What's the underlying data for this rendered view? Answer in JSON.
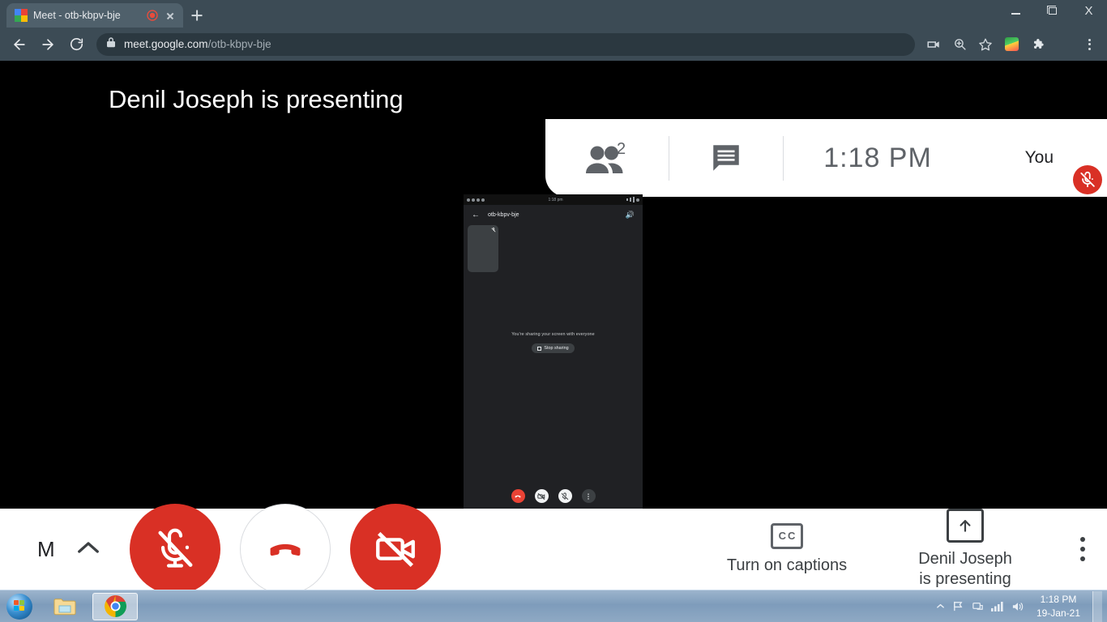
{
  "browser": {
    "tab": {
      "title": "Meet - otb-kbpv-bje",
      "favicon": "google-meet-favicon",
      "recording_indicator": "tab-recording-dot",
      "close": "close-icon"
    },
    "new_tab_label": "+",
    "window_controls": {
      "minimize": "minimize-icon",
      "restore": "restore-icon",
      "close": "X"
    },
    "nav": {
      "back": "back-arrow-icon",
      "forward": "forward-arrow-icon",
      "reload": "reload-icon"
    },
    "omnibox": {
      "lock": "lock-icon",
      "domain": "meet.google.com",
      "path": "/otb-kbpv-bje"
    },
    "toolbar_icons": [
      "cast-icon",
      "zoom-icon",
      "bookmark-star-icon",
      "idm-extension-icon",
      "extensions-puzzle-icon",
      "profile-avatar",
      "chrome-menu-kebab"
    ]
  },
  "meet": {
    "presenting_banner": {
      "avatar": "presenter-avatar",
      "text": "Denil Joseph is presenting"
    },
    "header_panel": {
      "people": {
        "icon": "people-icon",
        "count": "2"
      },
      "chat": {
        "icon": "chat-icon"
      },
      "time": "1:18 PM",
      "self": {
        "label": "You",
        "avatar": "self-avatar",
        "mic_badge": "mic-off-icon"
      }
    },
    "shared_screen": {
      "status_bar_left": "android-status-icons",
      "status_bar_time": "1:18 pm",
      "status_bar_right": "signal-wifi-battery",
      "back_icon": "back-arrow-icon",
      "meeting_code": "otb-kbpv-bje",
      "speaker_icon": "speaker-icon",
      "tile": {
        "avatar": "participant-avatar",
        "mic": "mic-off-icon"
      },
      "message": "You're sharing your screen with everyone",
      "stop_button": {
        "icon": "stop-present-icon",
        "label": "Stop sharing"
      },
      "controls": [
        {
          "name": "hangup",
          "icon": "phone-hangup-icon",
          "style": "hang"
        },
        {
          "name": "camera-off",
          "icon": "camera-off-icon",
          "style": "light"
        },
        {
          "name": "mic-off",
          "icon": "mic-off-icon",
          "style": "light"
        },
        {
          "name": "more-options",
          "icon": "kebab-icon",
          "style": "dark"
        }
      ]
    },
    "control_bar": {
      "meeting_details": "M",
      "expand_icon": "chevron-up-icon",
      "mic_button": {
        "icon": "mic-off-icon",
        "state": "muted"
      },
      "hangup_button": {
        "icon": "phone-hangup-icon"
      },
      "camera_button": {
        "icon": "camera-off-icon",
        "state": "off"
      },
      "captions": {
        "icon": "cc-icon",
        "label": "Turn on captions"
      },
      "present": {
        "icon": "present-up-arrow-icon",
        "label_line1": "Denil Joseph",
        "label_line2": "is presenting"
      },
      "more_options": "kebab-icon"
    }
  },
  "taskbar": {
    "start": "windows-start-orb",
    "items": [
      {
        "name": "file-explorer",
        "icon": "folder-icon",
        "active": false
      },
      {
        "name": "google-chrome",
        "icon": "chrome-icon",
        "active": true
      }
    ],
    "tray": [
      "show-hidden-icons",
      "action-center-flag-icon",
      "network-icon",
      "signal-bars-icon",
      "volume-icon"
    ],
    "clock": {
      "time": "1:18 PM",
      "date": "19-Jan-21"
    }
  },
  "colors": {
    "chrome_frame": "#3c4b55",
    "meet_red": "#d93025",
    "meet_bg": "#000000",
    "panel_white": "#ffffff",
    "grey_text": "#5f6368"
  }
}
